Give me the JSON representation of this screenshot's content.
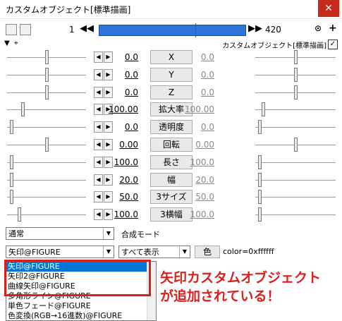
{
  "window": {
    "title": "カスタムオブジェクト[標準描画]",
    "close": "✕"
  },
  "toolbar": {
    "frame_start": "1",
    "frame_end": "420",
    "prev": "◀◀",
    "next": "▶▶",
    "lock": "⊙",
    "add": "+"
  },
  "header": {
    "label": "カスタムオブジェクト[標準描画]",
    "checked": "✓"
  },
  "params": [
    {
      "name": "X",
      "left": "0.0",
      "right": "0.0",
      "ltrack": 0.5,
      "rtrack": 0.5
    },
    {
      "name": "Y",
      "left": "0.0",
      "right": "0.0",
      "ltrack": 0.5,
      "rtrack": 0.5
    },
    {
      "name": "Z",
      "left": "0.0",
      "right": "0.0",
      "ltrack": 0.5,
      "rtrack": 0.5
    },
    {
      "name": "拡大率",
      "left": "100.00",
      "right": "100.00",
      "ltrack": 0.2,
      "rtrack": 0.1
    },
    {
      "name": "透明度",
      "left": "0.0",
      "right": "0.0",
      "ltrack": 0.05,
      "rtrack": 0.05
    },
    {
      "name": "回転",
      "left": "0.00",
      "right": "0.00",
      "ltrack": 0.5,
      "rtrack": 0.5
    },
    {
      "name": "長さ",
      "left": "100.0",
      "right": "100.0",
      "ltrack": 0.05,
      "rtrack": 0.05
    },
    {
      "name": "幅",
      "left": "20.0",
      "right": "20.0",
      "ltrack": 0.05,
      "rtrack": 0.05
    },
    {
      "name": "3サイズ",
      "left": "50.0",
      "right": "50.0",
      "ltrack": 0.05,
      "rtrack": 0.05
    },
    {
      "name": "3横幅",
      "left": "100.0",
      "right": "100.0",
      "ltrack": 0.15,
      "rtrack": 0.05
    }
  ],
  "blend": {
    "value": "通常",
    "label": "合成モード"
  },
  "object": {
    "value": "矢印@FIGURE",
    "filter": "すべて表示",
    "color_button": "色",
    "color_value": "color=0xffffff"
  },
  "list": {
    "items": [
      "矢印@FIGURE",
      "矢印2@FIGURE",
      "曲線矢印@FIGURE",
      "多角形ライン@FIGURE",
      "単色フェード@FIGURE",
      "色変換(RGB→16進数)@FIGURE"
    ],
    "selected_index": 0
  },
  "annotation": {
    "line1": "矢印カスタムオブジェクト",
    "line2": "が追加されている！"
  }
}
